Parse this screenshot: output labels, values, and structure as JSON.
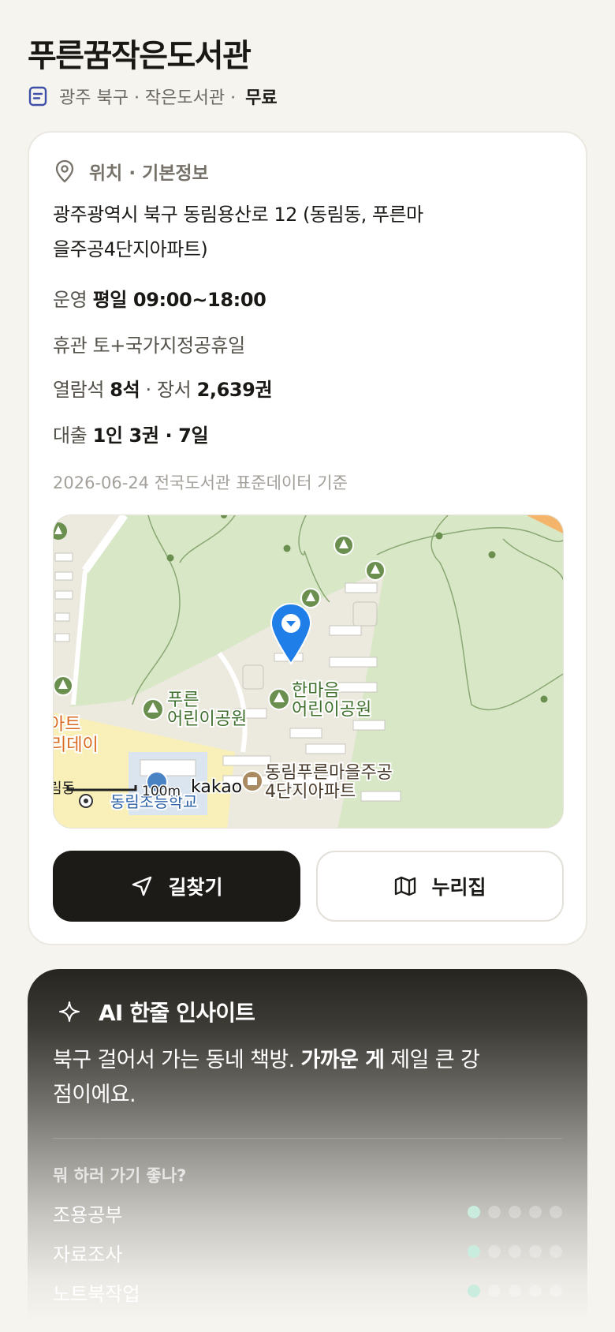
{
  "header": {
    "title": "푸른꿈작은도서관",
    "meta_prefix": "광주 북구 · 작은도서관 ·",
    "fee": "무료"
  },
  "info": {
    "section_title": "위치 · 기본정보",
    "address": "광주광역시 북구 동림용산로 12 (동림동, 푸른마을주공4단지아파트)",
    "hours_label": "운영",
    "hours_value": "평일 09:00~18:00",
    "closed_label": "휴관",
    "closed_value": "토+국가지정공휴일",
    "seats_label": "열람석",
    "seats_value": "8석",
    "books_label": "· 장서",
    "books_value": "2,639권",
    "loan_label": "대출",
    "loan_value": "1인 3권 · 7일",
    "updated": "2026-06-24 전국도서관 표준데이터 기준"
  },
  "map": {
    "labels": {
      "park1_line1": "푸른",
      "park1_line2": "어린이공원",
      "park2_line1": "한마음",
      "park2_line2": "어린이공원",
      "apt_line1": "동림푸른마을주공",
      "apt_line2": "4단지아파트",
      "left_orange_1": "아트",
      "left_orange_2": "리데이",
      "school": "동림초등학교",
      "left_edge": "림동",
      "scale": "100m",
      "brand": "kakao"
    }
  },
  "actions": {
    "directions": "길찾기",
    "site": "누리집"
  },
  "ai": {
    "title": "AI 한줄 인사이트",
    "text_before": "북구 걸어서 가는 동네 책방. ",
    "text_bold": "가까운 게",
    "text_after": " 제일 큰 강점이에요.",
    "subtitle": "뭐 하러 가기 좋나?",
    "fits": [
      {
        "label": "조용공부",
        "score": 1,
        "max": 5
      },
      {
        "label": "자료조사",
        "score": 1,
        "max": 5
      },
      {
        "label": "노트북작업",
        "score": 1,
        "max": 5
      }
    ]
  }
}
